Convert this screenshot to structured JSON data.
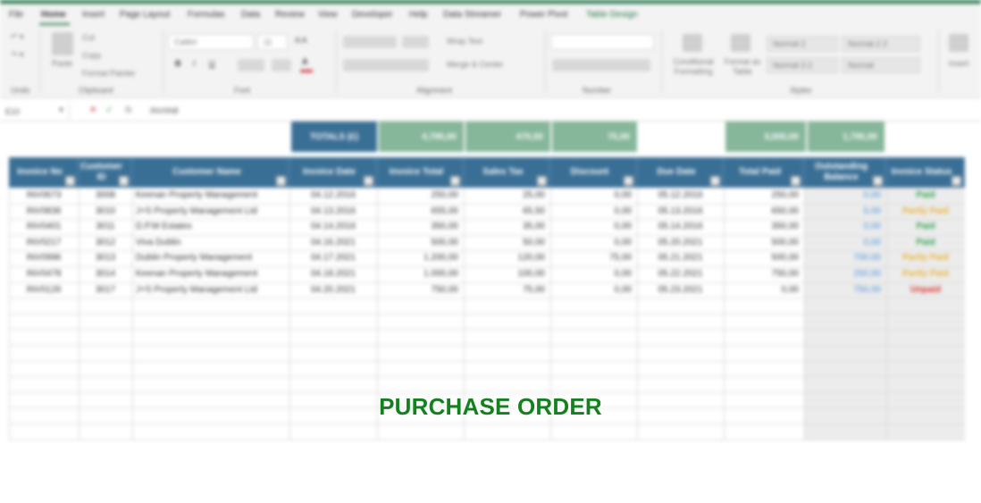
{
  "ribbon": {
    "tabs": [
      "File",
      "Home",
      "Insert",
      "Page Layout",
      "Formulas",
      "Data",
      "Review",
      "View",
      "Developer",
      "Help",
      "Data Streamer",
      "Power Pivot",
      "Table Design"
    ],
    "active_tab": "Home",
    "clipboard": {
      "paste": "Paste",
      "cut": "Cut",
      "copy": "Copy",
      "format_painter": "Format Painter",
      "group": "Clipboard"
    },
    "undo_group": "Undo",
    "font": {
      "name": "Calibri",
      "size": "11",
      "group": "Font"
    },
    "alignment": {
      "wrap": "Wrap Text",
      "merge": "Merge & Center",
      "group": "Alignment"
    },
    "number": {
      "format": "",
      "group": "Number"
    },
    "styles": {
      "conditional": "Conditional Formatting",
      "format_table": "Format as Table",
      "cells": [
        "Normal 2",
        "Normal 2 2",
        "Normal 3 2",
        "Normal"
      ],
      "group": "Styles"
    },
    "insert": "Insert"
  },
  "formula_bar": {
    "name_box": "E10",
    "content": "INV0N8"
  },
  "totals": {
    "label": "TOTALS (£)",
    "invoice_total": "4,795,00",
    "sales_tax": "470,50",
    "discount": "75,00",
    "total_paid": "3,000,00",
    "outstanding": "1,795,00"
  },
  "table": {
    "headers": [
      "Invoice No",
      "Customer ID",
      "Customer Name",
      "Invoice Date",
      "Invoice Total",
      "Sales Tax",
      "Discount",
      "Due Date",
      "Total Paid",
      "Outstanding Balance",
      "Invoice Status"
    ],
    "rows": [
      [
        "INV0673",
        "3008",
        "Keenan Property Management",
        "04.12.2016",
        "250,00",
        "25,00",
        "0,00",
        "05.12.2016",
        "250,00",
        "0,00",
        "Paid"
      ],
      [
        "INV0836",
        "3010",
        "J+S Property Management Ltd",
        "04.13.2016",
        "655,00",
        "65,50",
        "0,00",
        "05.13.2016",
        "650,00",
        "5,00",
        "Partly Paid"
      ],
      [
        "INV0401",
        "3011",
        "D.P.M Estates",
        "04.14.2016",
        "350,00",
        "35,00",
        "0,00",
        "05.14.2016",
        "350,00",
        "0,00",
        "Paid"
      ],
      [
        "INV0217",
        "3012",
        "Viva Dublin",
        "04.16.2021",
        "500,00",
        "50,00",
        "0,00",
        "05.20.2021",
        "500,00",
        "0,00",
        "Paid"
      ],
      [
        "INV0996",
        "3013",
        "Dublin Property Management",
        "04.17.2021",
        "1.200,00",
        "120,00",
        "75,00",
        "05.21.2021",
        "500,00",
        "700,00",
        "Partly Paid"
      ],
      [
        "INV0478",
        "3014",
        "Keenan Property Management",
        "04.18.2021",
        "1.000,00",
        "100,00",
        "0,00",
        "05.22.2021",
        "750,00",
        "250,00",
        "Partly Paid"
      ],
      [
        "INV0126",
        "3017",
        "J+S Property Management Ltd",
        "04.20.2021",
        "750,00",
        "75,00",
        "0,00",
        "05.23.2021",
        "0,00",
        "750,00",
        "Unpaid"
      ]
    ]
  },
  "status_colors": {
    "Paid": "#2e9e4f",
    "Partly Paid": "#e8b23a",
    "Unpaid": "#d9342b"
  },
  "overlay": {
    "title": "PURCHASE ORDER",
    "color": "#13811e"
  }
}
